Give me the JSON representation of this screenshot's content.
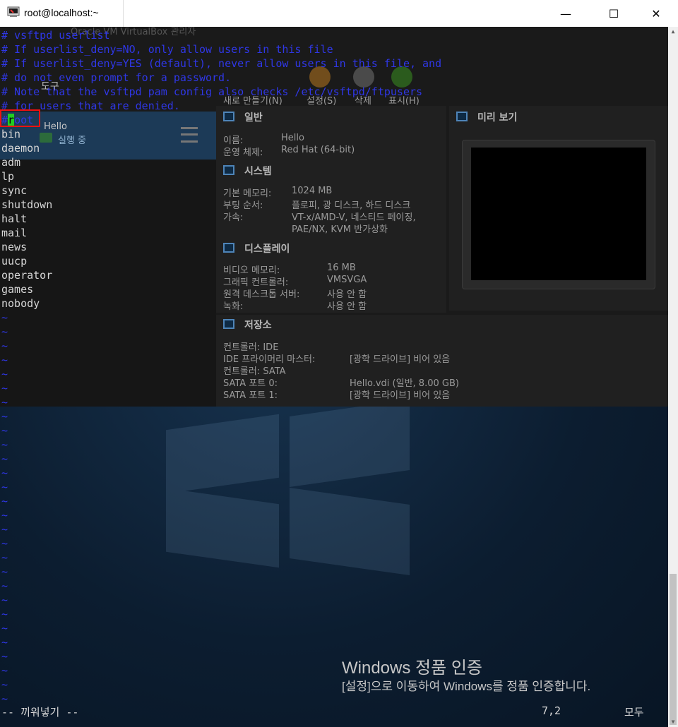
{
  "window": {
    "title": "root@localhost:~",
    "minimize": "—",
    "maximize": "☐",
    "close": "✕"
  },
  "vim": {
    "comment_lines": [
      "# vsftpd userlist",
      "# If userlist_deny=NO, only allow users in this file",
      "# If userlist_deny=YES (default), never allow users in this file, and",
      "# do not even prompt for a password.",
      "# Note that the vsftpd pam config also checks /etc/vsftpd/ftpusers",
      "# for users that are denied."
    ],
    "cursor_line": {
      "prefix": "#",
      "cursor_char": "r",
      "rest": "oot"
    },
    "users": [
      "bin",
      "daemon",
      "adm",
      "lp",
      "sync",
      "shutdown",
      "halt",
      "mail",
      "news",
      "uucp",
      "operator",
      "games",
      "nobody"
    ],
    "tilde": "~",
    "mode": "-- 끼워넣기 --",
    "position": "7,2",
    "scroll": "모두"
  },
  "vbox_ghost": {
    "title": "Oracle VM VirtualBox 관리자",
    "tools_label": "도구",
    "vm_name": "Hello",
    "vm_state": "실행 중",
    "toolbar": [
      "새로 만들기(N)",
      "설정(S)",
      "삭제",
      "표시(H)"
    ],
    "general_head": "일반",
    "general": [
      [
        "이름:",
        "Hello"
      ],
      [
        "운영 체제:",
        "Red Hat (64-bit)"
      ]
    ],
    "system_head": "시스템",
    "system": [
      [
        "기본 메모리:",
        "1024 MB"
      ],
      [
        "부팅 순서:",
        "플로피, 광 디스크, 하드 디스크"
      ],
      [
        "가속:",
        "VT-x/AMD-V, 네스티드 페이징,"
      ],
      [
        "",
        "PAE/NX, KVM 반가상화"
      ]
    ],
    "display_head": "디스플레이",
    "display": [
      [
        "비디오 메모리:",
        "16 MB"
      ],
      [
        "그래픽 컨트롤러:",
        "VMSVGA"
      ],
      [
        "원격 데스크톱 서버:",
        "사용 안 함"
      ],
      [
        "녹화:",
        "사용 안 함"
      ]
    ],
    "storage_head": "저장소",
    "storage": [
      [
        "컨트롤러: IDE",
        ""
      ],
      [
        "  IDE 프라이머리 마스터:",
        "[광학 드라이브] 비어 있음"
      ],
      [
        "컨트롤러: SATA",
        ""
      ],
      [
        "  SATA 포트 0:",
        "Hello.vdi (일반, 8.00 GB)"
      ],
      [
        "  SATA 포트 1:",
        "[광학 드라이브] 비어 있음"
      ]
    ],
    "preview_head": "미리 보기"
  },
  "watermark": {
    "title": "Windows 정품 인증",
    "subtitle": "[설정]으로 이동하여 Windows를 정품 인증합니다."
  }
}
